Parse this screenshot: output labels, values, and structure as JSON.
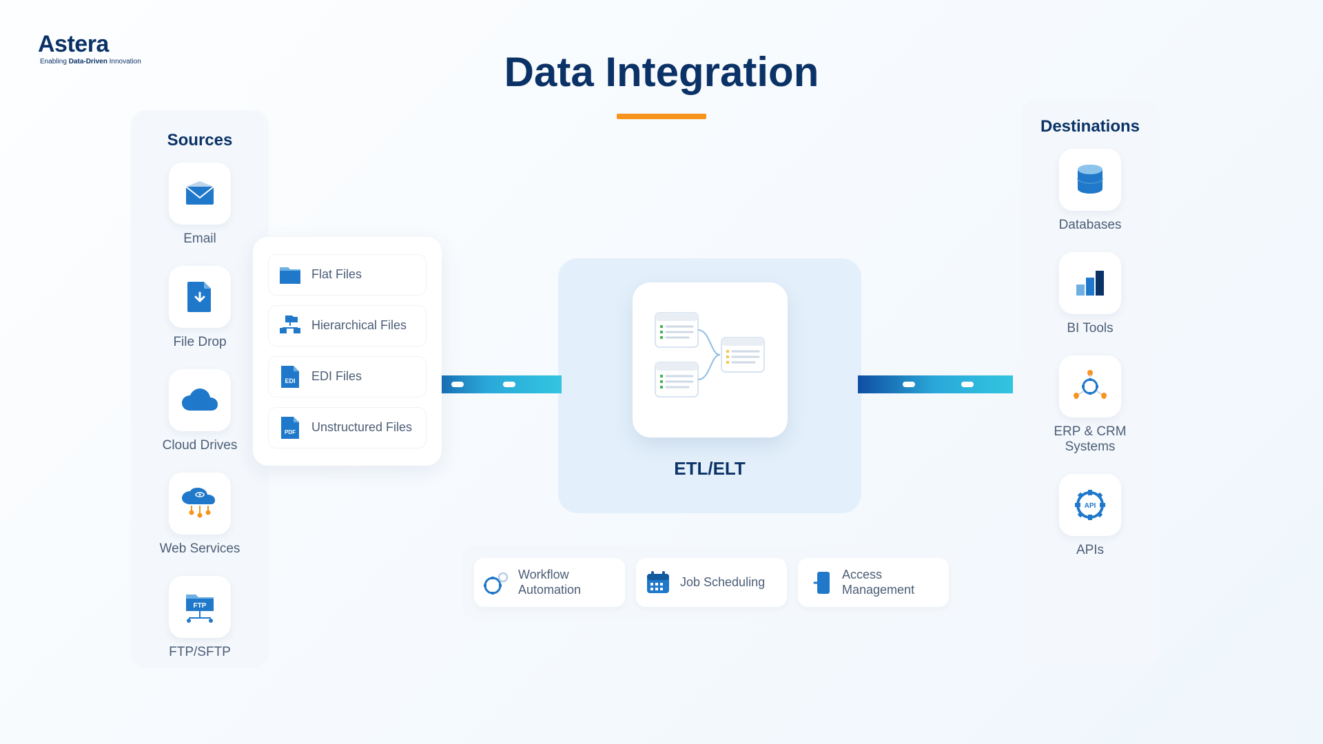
{
  "brand": {
    "name": "Astera",
    "tagline_pre": "Enabling ",
    "tagline_bold": "Data-Driven",
    "tagline_post": " Innovation"
  },
  "title": "Data Integration",
  "sources": {
    "heading": "Sources",
    "items": [
      {
        "label": "Email",
        "icon": "email-icon"
      },
      {
        "label": "File Drop",
        "icon": "file-drop-icon"
      },
      {
        "label": "Cloud Drives",
        "icon": "cloud-icon"
      },
      {
        "label": "Web Services",
        "icon": "web-services-icon"
      },
      {
        "label": "FTP/SFTP",
        "icon": "ftp-icon"
      }
    ]
  },
  "file_types": [
    {
      "label": "Flat Files"
    },
    {
      "label": "Hierarchical Files"
    },
    {
      "label": "EDI Files"
    },
    {
      "label": "Unstructured Files"
    }
  ],
  "center": {
    "label": "ETL/ELT"
  },
  "features": [
    {
      "label": "Workflow Automation"
    },
    {
      "label": "Job Scheduling"
    },
    {
      "label": "Access Management"
    }
  ],
  "destinations": {
    "heading": "Destinations",
    "items": [
      {
        "label": "Databases"
      },
      {
        "label": "BI Tools"
      },
      {
        "label": "ERP & CRM Systems"
      },
      {
        "label": "APIs"
      }
    ]
  }
}
